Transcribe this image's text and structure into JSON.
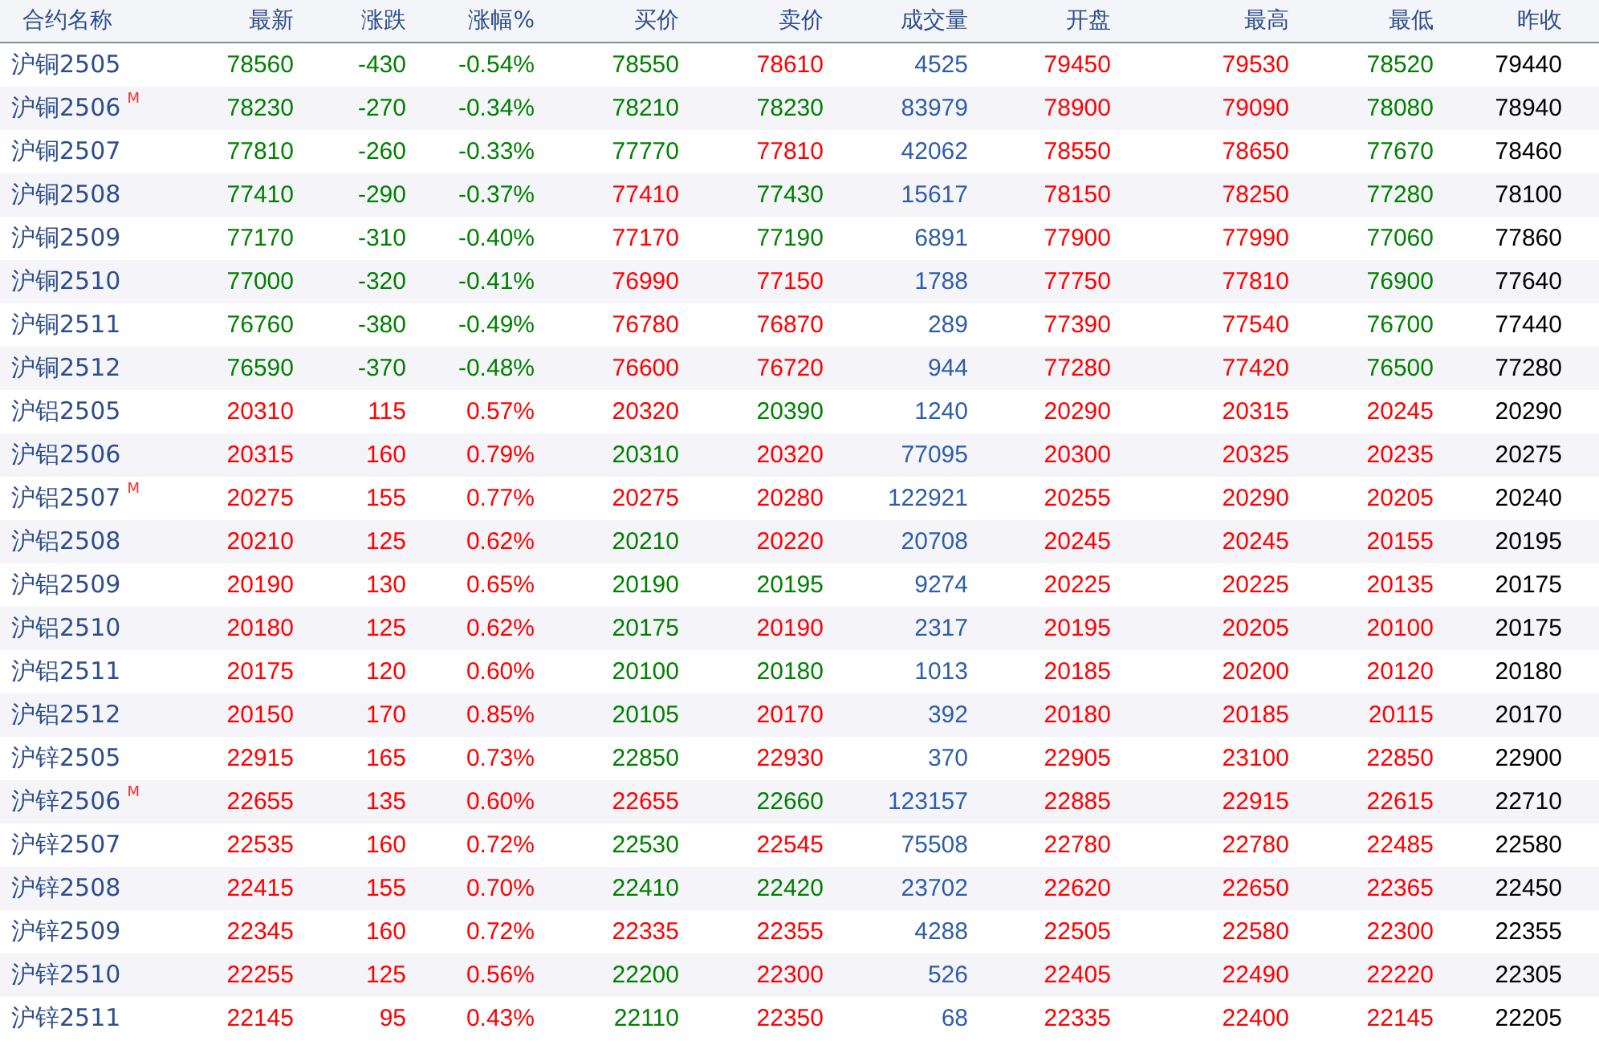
{
  "columns": [
    "合约名称",
    "最新",
    "涨跌",
    "涨幅%",
    "买价",
    "卖价",
    "成交量",
    "开盘",
    "最高",
    "最低",
    "昨收"
  ],
  "rows": [
    {
      "name": "沪铜2505",
      "cells": [
        {
          "text": "78560",
          "color": "#008000"
        },
        {
          "text": "-430",
          "color": "#008000"
        },
        {
          "text": "-0.54%",
          "color": "#008000"
        },
        {
          "text": "78550",
          "color": "#008000"
        },
        {
          "text": "78610",
          "color": "#ff0000"
        },
        {
          "text": "4525",
          "color": "#2f5ea8"
        },
        {
          "text": "79450",
          "color": "#ff0000"
        },
        {
          "text": "79530",
          "color": "#ff0000"
        },
        {
          "text": "78520",
          "color": "#008000"
        },
        {
          "text": "79440",
          "color": "#000000"
        }
      ]
    },
    {
      "name": "沪铜2506",
      "badge": "M",
      "cells": [
        {
          "text": "78230",
          "color": "#008000"
        },
        {
          "text": "-270",
          "color": "#008000"
        },
        {
          "text": "-0.34%",
          "color": "#008000"
        },
        {
          "text": "78210",
          "color": "#008000"
        },
        {
          "text": "78230",
          "color": "#008000"
        },
        {
          "text": "83979",
          "color": "#2f5ea8"
        },
        {
          "text": "78900",
          "color": "#ff0000"
        },
        {
          "text": "79090",
          "color": "#ff0000"
        },
        {
          "text": "78080",
          "color": "#008000"
        },
        {
          "text": "78940",
          "color": "#000000"
        }
      ]
    },
    {
      "name": "沪铜2507",
      "cells": [
        {
          "text": "77810",
          "color": "#008000"
        },
        {
          "text": "-260",
          "color": "#008000"
        },
        {
          "text": "-0.33%",
          "color": "#008000"
        },
        {
          "text": "77770",
          "color": "#008000"
        },
        {
          "text": "77810",
          "color": "#ff0000"
        },
        {
          "text": "42062",
          "color": "#2f5ea8"
        },
        {
          "text": "78550",
          "color": "#ff0000"
        },
        {
          "text": "78650",
          "color": "#ff0000"
        },
        {
          "text": "77670",
          "color": "#008000"
        },
        {
          "text": "78460",
          "color": "#000000"
        }
      ]
    },
    {
      "name": "沪铜2508",
      "cells": [
        {
          "text": "77410",
          "color": "#008000"
        },
        {
          "text": "-290",
          "color": "#008000"
        },
        {
          "text": "-0.37%",
          "color": "#008000"
        },
        {
          "text": "77410",
          "color": "#ff0000"
        },
        {
          "text": "77430",
          "color": "#008000"
        },
        {
          "text": "15617",
          "color": "#2f5ea8"
        },
        {
          "text": "78150",
          "color": "#ff0000"
        },
        {
          "text": "78250",
          "color": "#ff0000"
        },
        {
          "text": "77280",
          "color": "#008000"
        },
        {
          "text": "78100",
          "color": "#000000"
        }
      ]
    },
    {
      "name": "沪铜2509",
      "cells": [
        {
          "text": "77170",
          "color": "#008000"
        },
        {
          "text": "-310",
          "color": "#008000"
        },
        {
          "text": "-0.40%",
          "color": "#008000"
        },
        {
          "text": "77170",
          "color": "#ff0000"
        },
        {
          "text": "77190",
          "color": "#008000"
        },
        {
          "text": "6891",
          "color": "#2f5ea8"
        },
        {
          "text": "77900",
          "color": "#ff0000"
        },
        {
          "text": "77990",
          "color": "#ff0000"
        },
        {
          "text": "77060",
          "color": "#008000"
        },
        {
          "text": "77860",
          "color": "#000000"
        }
      ]
    },
    {
      "name": "沪铜2510",
      "cells": [
        {
          "text": "77000",
          "color": "#008000"
        },
        {
          "text": "-320",
          "color": "#008000"
        },
        {
          "text": "-0.41%",
          "color": "#008000"
        },
        {
          "text": "76990",
          "color": "#ff0000"
        },
        {
          "text": "77150",
          "color": "#ff0000"
        },
        {
          "text": "1788",
          "color": "#2f5ea8"
        },
        {
          "text": "77750",
          "color": "#ff0000"
        },
        {
          "text": "77810",
          "color": "#ff0000"
        },
        {
          "text": "76900",
          "color": "#008000"
        },
        {
          "text": "77640",
          "color": "#000000"
        }
      ]
    },
    {
      "name": "沪铜2511",
      "cells": [
        {
          "text": "76760",
          "color": "#008000"
        },
        {
          "text": "-380",
          "color": "#008000"
        },
        {
          "text": "-0.49%",
          "color": "#008000"
        },
        {
          "text": "76780",
          "color": "#ff0000"
        },
        {
          "text": "76870",
          "color": "#ff0000"
        },
        {
          "text": "289",
          "color": "#2f5ea8"
        },
        {
          "text": "77390",
          "color": "#ff0000"
        },
        {
          "text": "77540",
          "color": "#ff0000"
        },
        {
          "text": "76700",
          "color": "#008000"
        },
        {
          "text": "77440",
          "color": "#000000"
        }
      ]
    },
    {
      "name": "沪铜2512",
      "cells": [
        {
          "text": "76590",
          "color": "#008000"
        },
        {
          "text": "-370",
          "color": "#008000"
        },
        {
          "text": "-0.48%",
          "color": "#008000"
        },
        {
          "text": "76600",
          "color": "#ff0000"
        },
        {
          "text": "76720",
          "color": "#ff0000"
        },
        {
          "text": "944",
          "color": "#2f5ea8"
        },
        {
          "text": "77280",
          "color": "#ff0000"
        },
        {
          "text": "77420",
          "color": "#ff0000"
        },
        {
          "text": "76500",
          "color": "#008000"
        },
        {
          "text": "77280",
          "color": "#000000"
        }
      ]
    },
    {
      "name": "沪铝2505",
      "cells": [
        {
          "text": "20310",
          "color": "#ff0000"
        },
        {
          "text": "115",
          "color": "#ff0000"
        },
        {
          "text": "0.57%",
          "color": "#ff0000"
        },
        {
          "text": "20320",
          "color": "#ff0000"
        },
        {
          "text": "20390",
          "color": "#008000"
        },
        {
          "text": "1240",
          "color": "#2f5ea8"
        },
        {
          "text": "20290",
          "color": "#ff0000"
        },
        {
          "text": "20315",
          "color": "#ff0000"
        },
        {
          "text": "20245",
          "color": "#ff0000"
        },
        {
          "text": "20290",
          "color": "#000000"
        }
      ]
    },
    {
      "name": "沪铝2506",
      "cells": [
        {
          "text": "20315",
          "color": "#ff0000"
        },
        {
          "text": "160",
          "color": "#ff0000"
        },
        {
          "text": "0.79%",
          "color": "#ff0000"
        },
        {
          "text": "20310",
          "color": "#008000"
        },
        {
          "text": "20320",
          "color": "#ff0000"
        },
        {
          "text": "77095",
          "color": "#2f5ea8"
        },
        {
          "text": "20300",
          "color": "#ff0000"
        },
        {
          "text": "20325",
          "color": "#ff0000"
        },
        {
          "text": "20235",
          "color": "#ff0000"
        },
        {
          "text": "20275",
          "color": "#000000"
        }
      ]
    },
    {
      "name": "沪铝2507",
      "badge": "M",
      "cells": [
        {
          "text": "20275",
          "color": "#ff0000"
        },
        {
          "text": "155",
          "color": "#ff0000"
        },
        {
          "text": "0.77%",
          "color": "#ff0000"
        },
        {
          "text": "20275",
          "color": "#ff0000"
        },
        {
          "text": "20280",
          "color": "#ff0000"
        },
        {
          "text": "122921",
          "color": "#2f5ea8"
        },
        {
          "text": "20255",
          "color": "#ff0000"
        },
        {
          "text": "20290",
          "color": "#ff0000"
        },
        {
          "text": "20205",
          "color": "#ff0000"
        },
        {
          "text": "20240",
          "color": "#000000"
        }
      ]
    },
    {
      "name": "沪铝2508",
      "cells": [
        {
          "text": "20210",
          "color": "#ff0000"
        },
        {
          "text": "125",
          "color": "#ff0000"
        },
        {
          "text": "0.62%",
          "color": "#ff0000"
        },
        {
          "text": "20210",
          "color": "#008000"
        },
        {
          "text": "20220",
          "color": "#ff0000"
        },
        {
          "text": "20708",
          "color": "#2f5ea8"
        },
        {
          "text": "20245",
          "color": "#ff0000"
        },
        {
          "text": "20245",
          "color": "#ff0000"
        },
        {
          "text": "20155",
          "color": "#ff0000"
        },
        {
          "text": "20195",
          "color": "#000000"
        }
      ]
    },
    {
      "name": "沪铝2509",
      "cells": [
        {
          "text": "20190",
          "color": "#ff0000"
        },
        {
          "text": "130",
          "color": "#ff0000"
        },
        {
          "text": "0.65%",
          "color": "#ff0000"
        },
        {
          "text": "20190",
          "color": "#008000"
        },
        {
          "text": "20195",
          "color": "#008000"
        },
        {
          "text": "9274",
          "color": "#2f5ea8"
        },
        {
          "text": "20225",
          "color": "#ff0000"
        },
        {
          "text": "20225",
          "color": "#ff0000"
        },
        {
          "text": "20135",
          "color": "#ff0000"
        },
        {
          "text": "20175",
          "color": "#000000"
        }
      ]
    },
    {
      "name": "沪铝2510",
      "cells": [
        {
          "text": "20180",
          "color": "#ff0000"
        },
        {
          "text": "125",
          "color": "#ff0000"
        },
        {
          "text": "0.62%",
          "color": "#ff0000"
        },
        {
          "text": "20175",
          "color": "#008000"
        },
        {
          "text": "20190",
          "color": "#ff0000"
        },
        {
          "text": "2317",
          "color": "#2f5ea8"
        },
        {
          "text": "20195",
          "color": "#ff0000"
        },
        {
          "text": "20205",
          "color": "#ff0000"
        },
        {
          "text": "20100",
          "color": "#ff0000"
        },
        {
          "text": "20175",
          "color": "#000000"
        }
      ]
    },
    {
      "name": "沪铝2511",
      "cells": [
        {
          "text": "20175",
          "color": "#ff0000"
        },
        {
          "text": "120",
          "color": "#ff0000"
        },
        {
          "text": "0.60%",
          "color": "#ff0000"
        },
        {
          "text": "20100",
          "color": "#008000"
        },
        {
          "text": "20180",
          "color": "#008000"
        },
        {
          "text": "1013",
          "color": "#2f5ea8"
        },
        {
          "text": "20185",
          "color": "#ff0000"
        },
        {
          "text": "20200",
          "color": "#ff0000"
        },
        {
          "text": "20120",
          "color": "#ff0000"
        },
        {
          "text": "20180",
          "color": "#000000"
        }
      ]
    },
    {
      "name": "沪铝2512",
      "cells": [
        {
          "text": "20150",
          "color": "#ff0000"
        },
        {
          "text": "170",
          "color": "#ff0000"
        },
        {
          "text": "0.85%",
          "color": "#ff0000"
        },
        {
          "text": "20105",
          "color": "#008000"
        },
        {
          "text": "20170",
          "color": "#ff0000"
        },
        {
          "text": "392",
          "color": "#2f5ea8"
        },
        {
          "text": "20180",
          "color": "#ff0000"
        },
        {
          "text": "20185",
          "color": "#ff0000"
        },
        {
          "text": "20115",
          "color": "#ff0000"
        },
        {
          "text": "20170",
          "color": "#000000"
        }
      ]
    },
    {
      "name": "沪锌2505",
      "cells": [
        {
          "text": "22915",
          "color": "#ff0000"
        },
        {
          "text": "165",
          "color": "#ff0000"
        },
        {
          "text": "0.73%",
          "color": "#ff0000"
        },
        {
          "text": "22850",
          "color": "#008000"
        },
        {
          "text": "22930",
          "color": "#ff0000"
        },
        {
          "text": "370",
          "color": "#2f5ea8"
        },
        {
          "text": "22905",
          "color": "#ff0000"
        },
        {
          "text": "23100",
          "color": "#ff0000"
        },
        {
          "text": "22850",
          "color": "#ff0000"
        },
        {
          "text": "22900",
          "color": "#000000"
        }
      ]
    },
    {
      "name": "沪锌2506",
      "badge": "M",
      "cells": [
        {
          "text": "22655",
          "color": "#ff0000"
        },
        {
          "text": "135",
          "color": "#ff0000"
        },
        {
          "text": "0.60%",
          "color": "#ff0000"
        },
        {
          "text": "22655",
          "color": "#ff0000"
        },
        {
          "text": "22660",
          "color": "#008000"
        },
        {
          "text": "123157",
          "color": "#2f5ea8"
        },
        {
          "text": "22885",
          "color": "#ff0000"
        },
        {
          "text": "22915",
          "color": "#ff0000"
        },
        {
          "text": "22615",
          "color": "#ff0000"
        },
        {
          "text": "22710",
          "color": "#000000"
        }
      ]
    },
    {
      "name": "沪锌2507",
      "cells": [
        {
          "text": "22535",
          "color": "#ff0000"
        },
        {
          "text": "160",
          "color": "#ff0000"
        },
        {
          "text": "0.72%",
          "color": "#ff0000"
        },
        {
          "text": "22530",
          "color": "#008000"
        },
        {
          "text": "22545",
          "color": "#ff0000"
        },
        {
          "text": "75508",
          "color": "#2f5ea8"
        },
        {
          "text": "22780",
          "color": "#ff0000"
        },
        {
          "text": "22780",
          "color": "#ff0000"
        },
        {
          "text": "22485",
          "color": "#ff0000"
        },
        {
          "text": "22580",
          "color": "#000000"
        }
      ]
    },
    {
      "name": "沪锌2508",
      "cells": [
        {
          "text": "22415",
          "color": "#ff0000"
        },
        {
          "text": "155",
          "color": "#ff0000"
        },
        {
          "text": "0.70%",
          "color": "#ff0000"
        },
        {
          "text": "22410",
          "color": "#008000"
        },
        {
          "text": "22420",
          "color": "#008000"
        },
        {
          "text": "23702",
          "color": "#2f5ea8"
        },
        {
          "text": "22620",
          "color": "#ff0000"
        },
        {
          "text": "22650",
          "color": "#ff0000"
        },
        {
          "text": "22365",
          "color": "#ff0000"
        },
        {
          "text": "22450",
          "color": "#000000"
        }
      ]
    },
    {
      "name": "沪锌2509",
      "cells": [
        {
          "text": "22345",
          "color": "#ff0000"
        },
        {
          "text": "160",
          "color": "#ff0000"
        },
        {
          "text": "0.72%",
          "color": "#ff0000"
        },
        {
          "text": "22335",
          "color": "#ff0000"
        },
        {
          "text": "22355",
          "color": "#ff0000"
        },
        {
          "text": "4288",
          "color": "#2f5ea8"
        },
        {
          "text": "22505",
          "color": "#ff0000"
        },
        {
          "text": "22580",
          "color": "#ff0000"
        },
        {
          "text": "22300",
          "color": "#ff0000"
        },
        {
          "text": "22355",
          "color": "#000000"
        }
      ]
    },
    {
      "name": "沪锌2510",
      "cells": [
        {
          "text": "22255",
          "color": "#ff0000"
        },
        {
          "text": "125",
          "color": "#ff0000"
        },
        {
          "text": "0.56%",
          "color": "#ff0000"
        },
        {
          "text": "22200",
          "color": "#008000"
        },
        {
          "text": "22300",
          "color": "#ff0000"
        },
        {
          "text": "526",
          "color": "#2f5ea8"
        },
        {
          "text": "22405",
          "color": "#ff0000"
        },
        {
          "text": "22490",
          "color": "#ff0000"
        },
        {
          "text": "22220",
          "color": "#ff0000"
        },
        {
          "text": "22305",
          "color": "#000000"
        }
      ]
    },
    {
      "name": "沪锌2511",
      "cells": [
        {
          "text": "22145",
          "color": "#ff0000"
        },
        {
          "text": "95",
          "color": "#ff0000"
        },
        {
          "text": "0.43%",
          "color": "#ff0000"
        },
        {
          "text": "22110",
          "color": "#008000"
        },
        {
          "text": "22350",
          "color": "#ff0000"
        },
        {
          "text": "68",
          "color": "#2f5ea8"
        },
        {
          "text": "22335",
          "color": "#ff0000"
        },
        {
          "text": "22400",
          "color": "#ff0000"
        },
        {
          "text": "22145",
          "color": "#ff0000"
        },
        {
          "text": "22205",
          "color": "#000000"
        }
      ]
    }
  ]
}
